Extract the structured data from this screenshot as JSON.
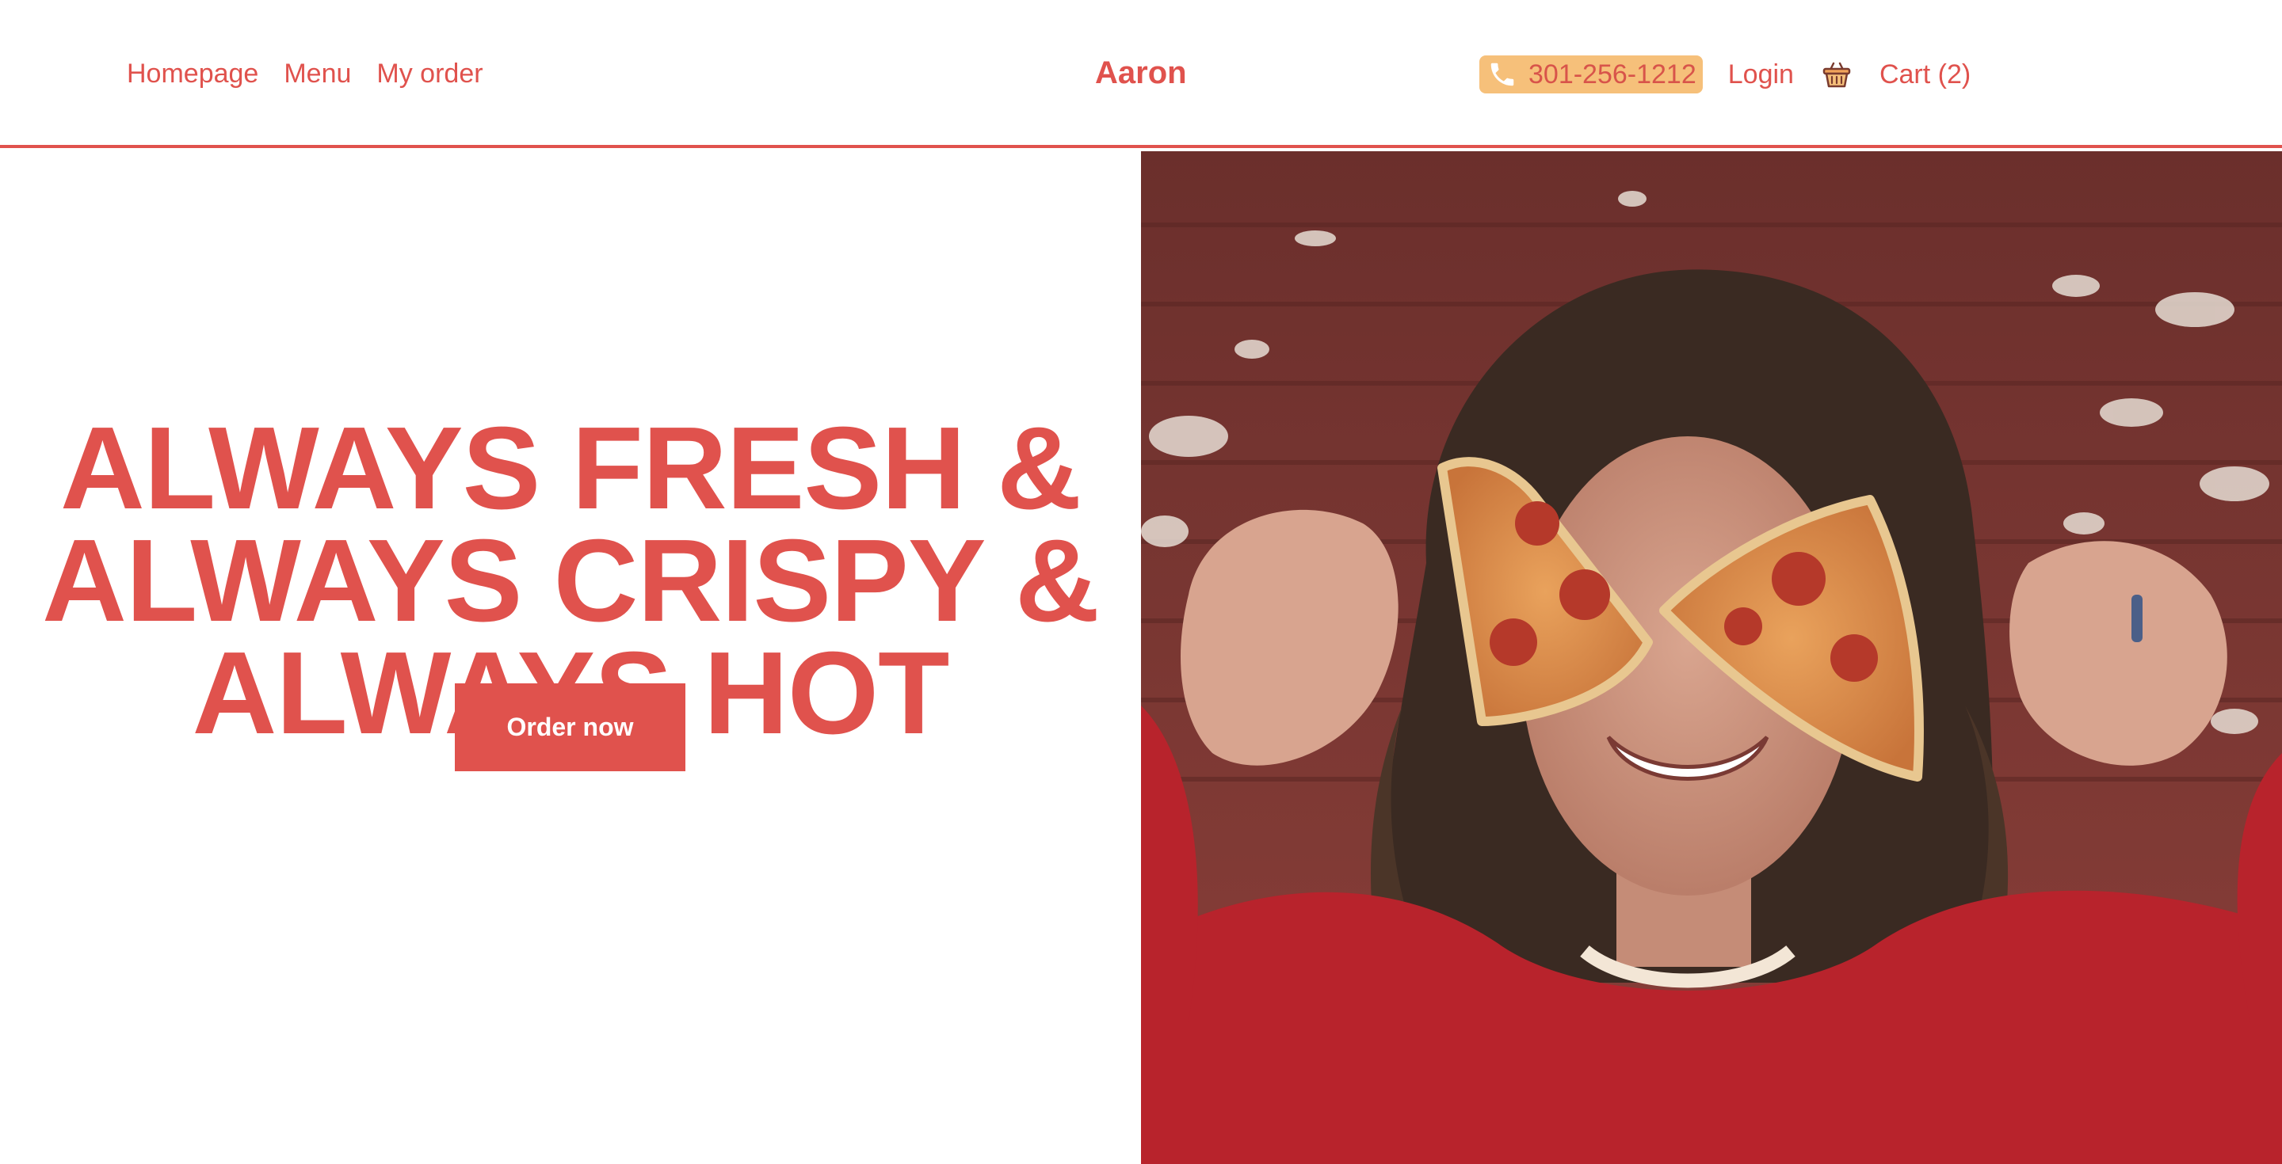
{
  "header": {
    "nav_left": [
      "Homepage",
      "Menu",
      "My order"
    ],
    "brand": "Aaron",
    "phone": "301-256-1212",
    "login": "Login",
    "cart": "Cart (2)"
  },
  "hero": {
    "headline_lines": [
      "ALWAYS FRESH &",
      "ALWAYS CRISPY &",
      "ALWAYS HOT"
    ],
    "cta": "Order now"
  },
  "icons": {
    "phone": "phone-icon",
    "cart": "basket-icon"
  },
  "colors": {
    "accent": "#e0524d",
    "phone_badge": "#f6c07a",
    "background": "#ffffff"
  }
}
